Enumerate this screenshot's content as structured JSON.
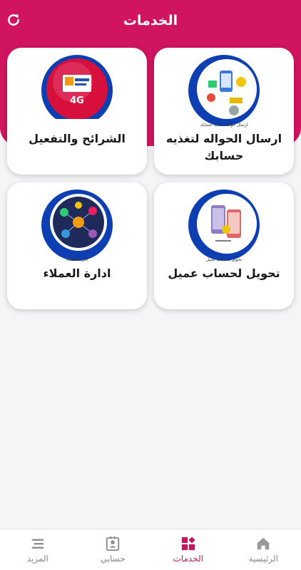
{
  "header": {
    "title": "الخدمات",
    "refresh_icon": "refresh-icon",
    "color": "#d1145f"
  },
  "services": [
    {
      "label": "ارسال الحواله لتغذيه حسابك",
      "icon": "money-transfer-icon",
      "image_caption": "ارسال حواله لتغذيه حسابك"
    },
    {
      "label": "الشرائح والتفعيل",
      "icon": "sim-card-4g-icon",
      "image_caption": "4G"
    },
    {
      "label": "تحويل لحساب عميل",
      "icon": "account-transfer-icon",
      "image_caption": "تحويل لحساب عميل"
    },
    {
      "label": "ادارة العملاء",
      "icon": "customers-network-icon",
      "image_caption": "ادارة العملاء"
    }
  ],
  "bottom_nav": [
    {
      "label": "الرئيسية",
      "icon": "home-icon",
      "active": false
    },
    {
      "label": "الخدمات",
      "icon": "services-grid-icon",
      "active": true
    },
    {
      "label": "حسابي",
      "icon": "account-card-icon",
      "active": false
    },
    {
      "label": "المزيد",
      "icon": "menu-lines-icon",
      "active": false
    }
  ],
  "colors": {
    "accent": "#c5165f",
    "emblem_blue": "#0d3fb3",
    "inactive": "#8a8a8a",
    "background": "#f5f5f7"
  }
}
